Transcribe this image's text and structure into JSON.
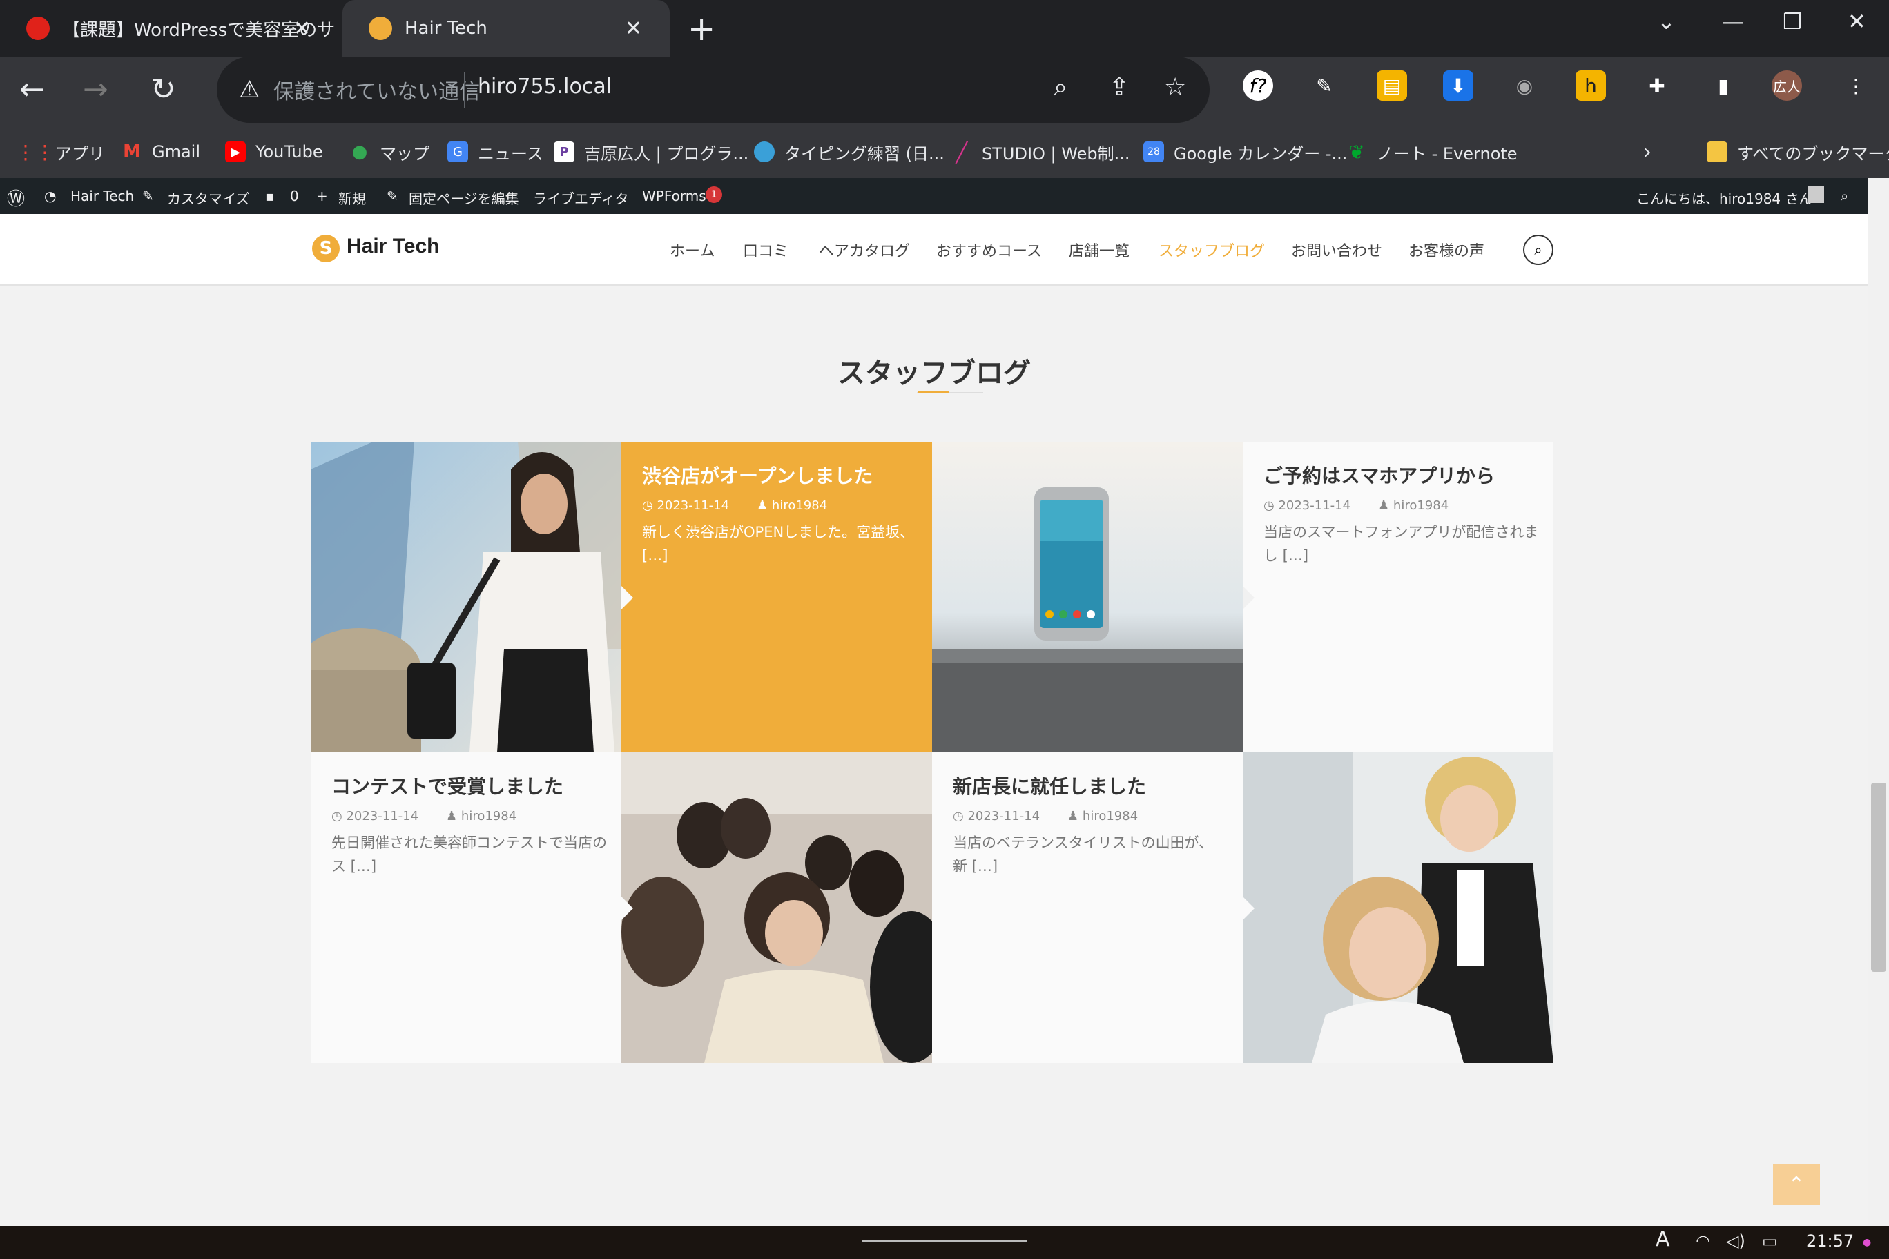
{
  "browser": {
    "tabs": [
      {
        "title": "【課題】WordPressで美容室のサ",
        "active": false
      },
      {
        "title": "Hair Tech",
        "active": true
      }
    ],
    "new_tab": "+",
    "address": {
      "security": "保護されていない通信",
      "url": "hiro755.local"
    },
    "profile": "広人",
    "bookmarks": [
      {
        "label": "アプリ",
        "icon": "apps-grid-icon",
        "color": "#ea4335"
      },
      {
        "label": "Gmail",
        "icon": "gmail-icon",
        "color": "#ea4335"
      },
      {
        "label": "YouTube",
        "icon": "youtube-icon",
        "color": "#ff0000"
      },
      {
        "label": "マップ",
        "icon": "maps-icon",
        "color": "#34a853"
      },
      {
        "label": "ニュース",
        "icon": "news-icon",
        "color": "#4285f4"
      },
      {
        "label": "吉原広人 | プログラ...",
        "icon": "portfolio-icon",
        "color": "#6b3fa0"
      },
      {
        "label": "タイピング練習 (日...",
        "icon": "typing-icon",
        "color": "#3aa0d8"
      },
      {
        "label": "STUDIO | Web制...",
        "icon": "studio-icon",
        "color": "#d6338c"
      },
      {
        "label": "Google カレンダー -...",
        "icon": "calendar-icon",
        "color": "#4285f4"
      },
      {
        "label": "ノート - Evernote",
        "icon": "evernote-icon",
        "color": "#00a82d"
      }
    ],
    "all_bookmarks": "すべてのブックマーク"
  },
  "adminbar": {
    "site": "Hair Tech",
    "customize": "カスタマイズ",
    "comments": "0",
    "new": "新規",
    "edit": "固定ページを編集",
    "live_editor": "ライブエディタ",
    "wpforms": "WPForms",
    "wpforms_badge": "1",
    "greeting": "こんにちは、hiro1984 さん"
  },
  "site": {
    "logo": "Hair Tech",
    "logo_mark": "S",
    "nav": [
      "ホーム",
      "口コミ",
      "ヘアカタログ",
      "おすすめコース",
      "店舗一覧",
      "スタッフブログ",
      "お問い合わせ",
      "お客様の声"
    ],
    "active_nav": "スタッフブログ",
    "accent_color": "#f0ad3a"
  },
  "blog": {
    "section_title": "スタッフブログ",
    "posts": [
      {
        "title": "渋谷店がオープンしました",
        "date": "2023-11-14",
        "author": "hiro1984",
        "excerpt": "新しく渋谷店がOPENしました。宮益坂、[…]",
        "image": "woman-walking-city-photo"
      },
      {
        "title": "ご予約はスマホアプリから",
        "date": "2023-11-14",
        "author": "hiro1984",
        "excerpt": "当店のスマートフォンアプリが配信されまし […]",
        "image": "smartphone-on-table-photo"
      },
      {
        "title": "コンテストで受賞しました",
        "date": "2023-11-14",
        "author": "hiro1984",
        "excerpt": "先日開催された美容師コンテストで当店のス […]",
        "image": "stylist-team-photo"
      },
      {
        "title": "新店長に就任しました",
        "date": "2023-11-14",
        "author": "hiro1984",
        "excerpt": "当店のベテランスタイリストの山田が、 新 […]",
        "image": "salon-hairstyling-photo"
      }
    ]
  },
  "taskbar": {
    "time": "21:57",
    "ime": "A"
  }
}
